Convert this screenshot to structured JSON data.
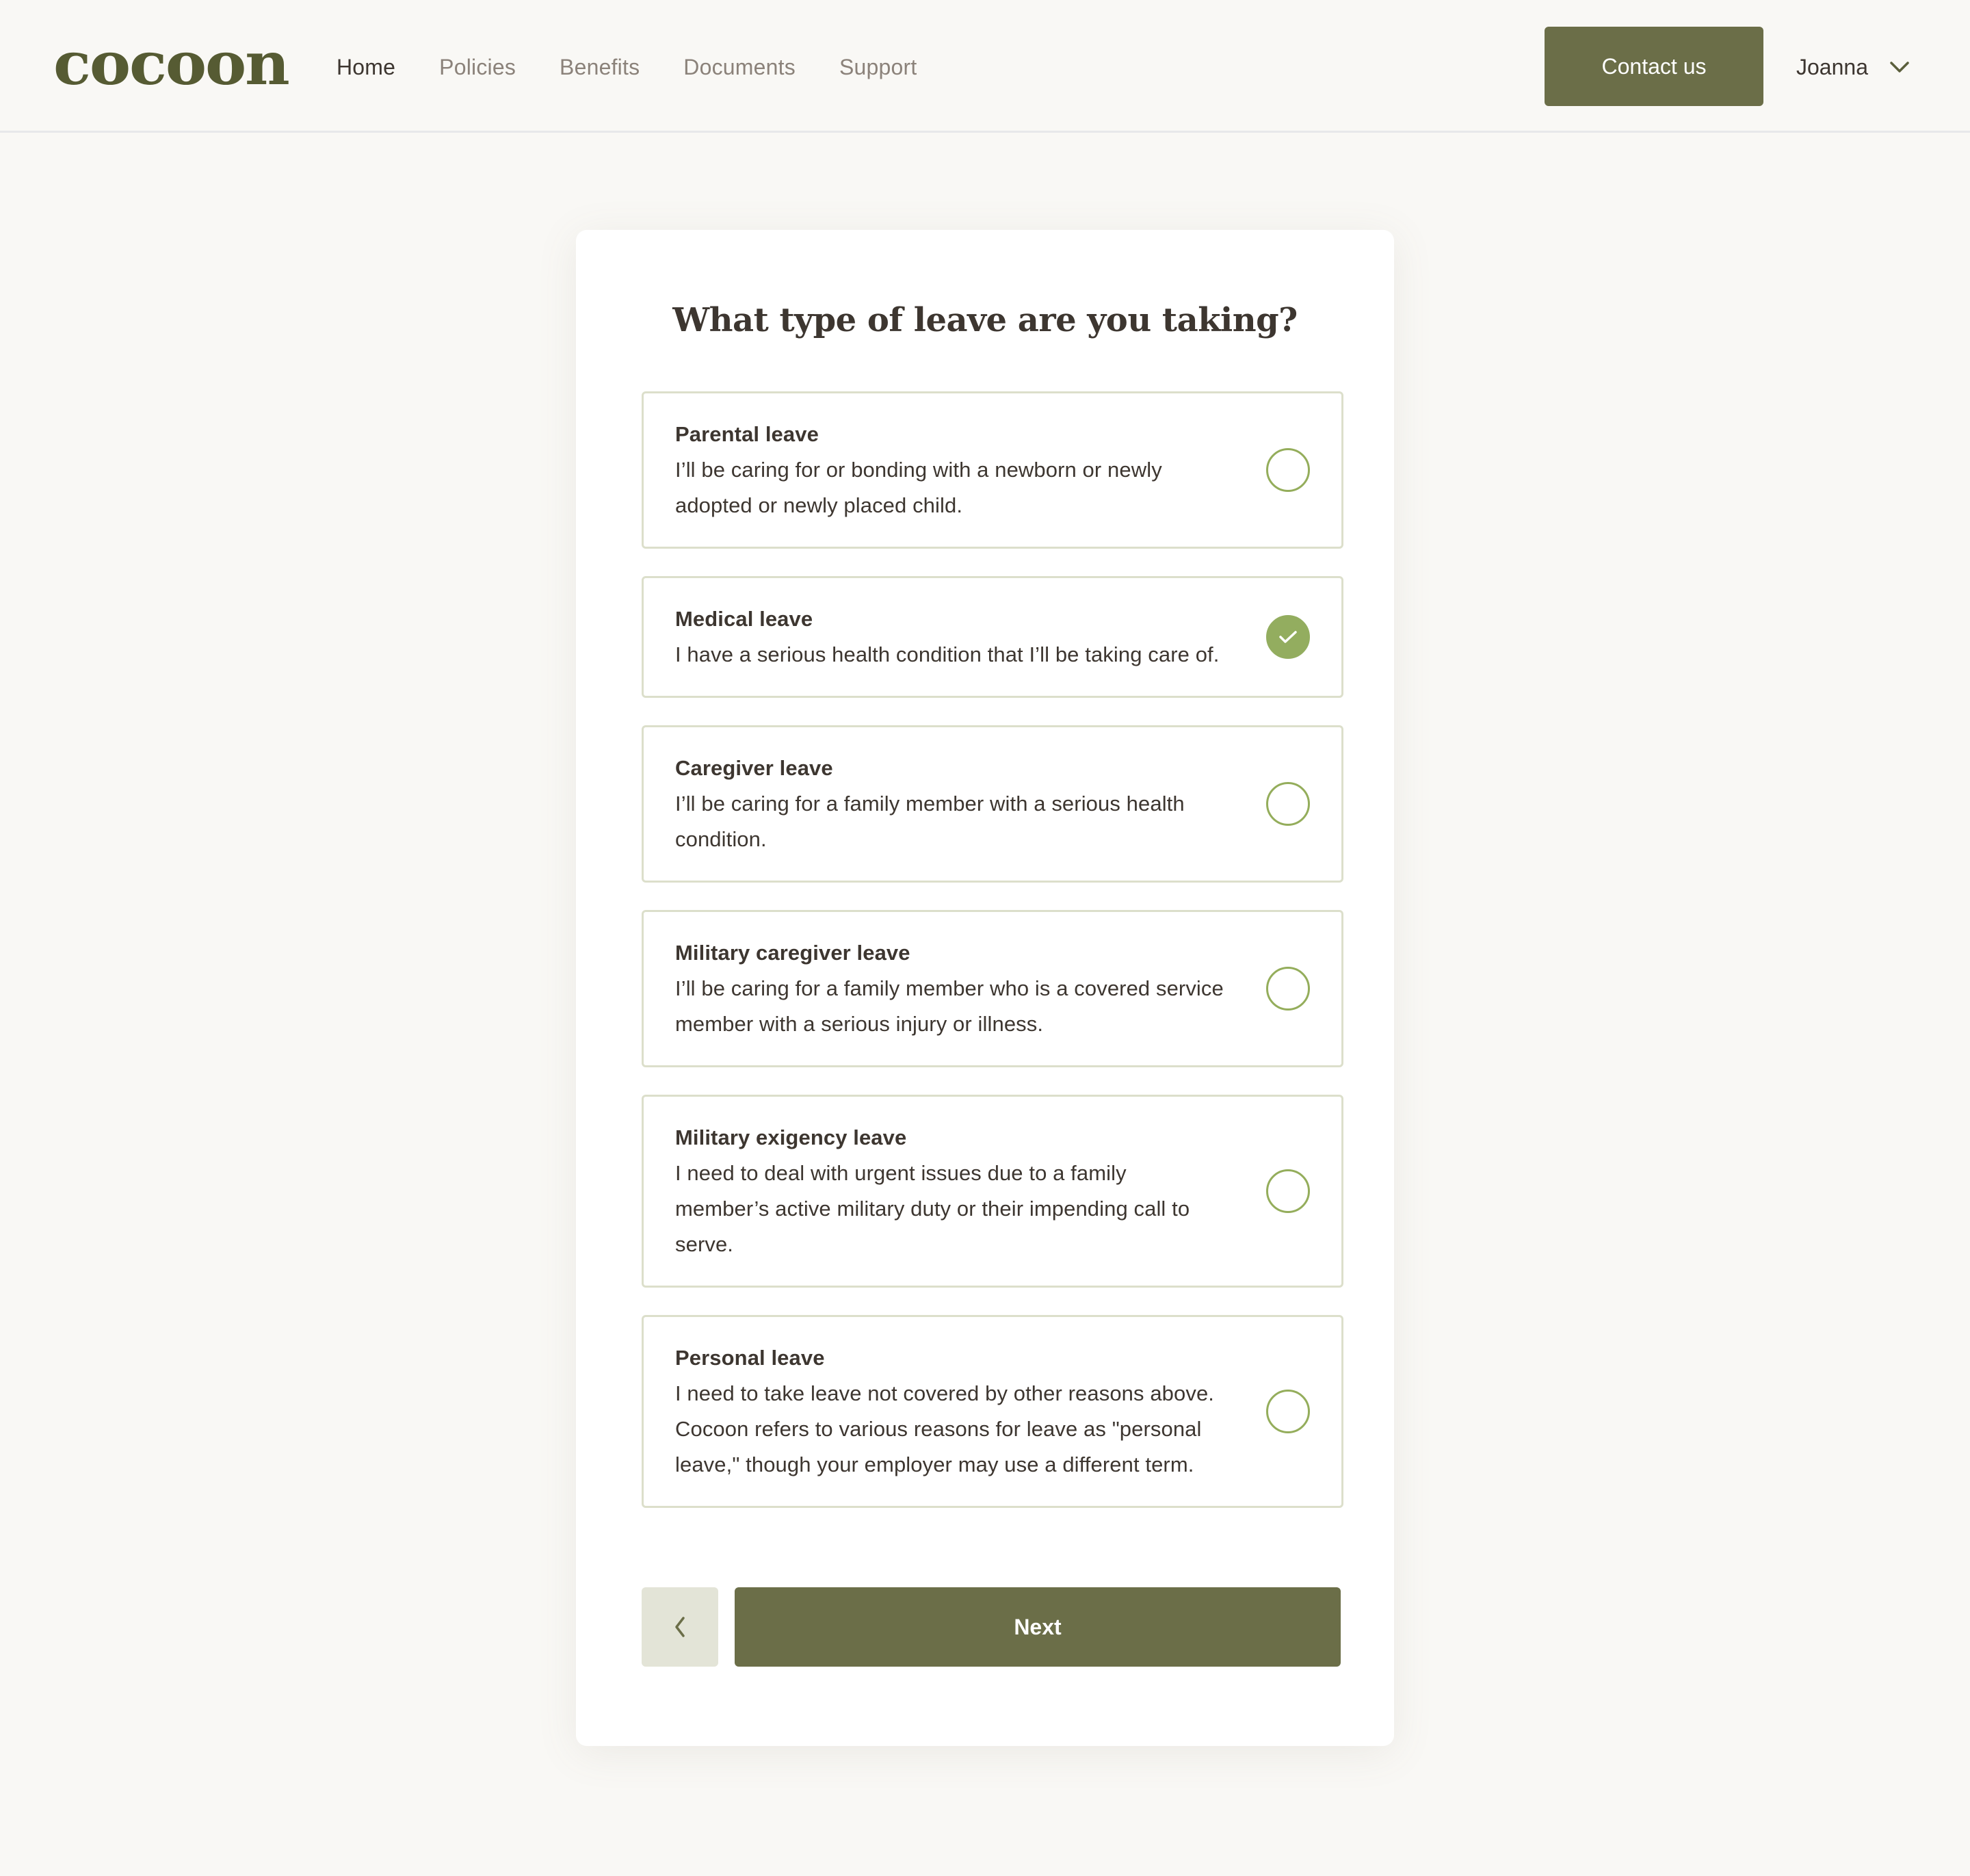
{
  "brand": {
    "logo_text": "cocoon",
    "primary_color": "#6b6e48",
    "logo_color": "#565b33",
    "accent_green": "#93ad5f",
    "background": "#f9f8f5"
  },
  "header": {
    "nav": [
      {
        "label": "Home",
        "active": true
      },
      {
        "label": "Policies",
        "active": false
      },
      {
        "label": "Benefits",
        "active": false
      },
      {
        "label": "Documents",
        "active": false
      },
      {
        "label": "Support",
        "active": false
      }
    ],
    "contact_label": "Contact us",
    "user_name": "Joanna",
    "user_menu_icon": "chevron-down-icon"
  },
  "form": {
    "question": "What type of leave are you taking?",
    "options": [
      {
        "title": "Parental leave",
        "description": "I’ll be caring for or bonding with a newborn or newly adopted or newly placed child.",
        "selected": false
      },
      {
        "title": "Medical leave",
        "description": "I have a serious health condition that I’ll be taking care of.",
        "selected": true
      },
      {
        "title": "Caregiver leave",
        "description": "I’ll be caring for a family member with a serious health condition.",
        "selected": false
      },
      {
        "title": "Military caregiver leave",
        "description": "I’ll be caring for a family member who is a covered service member with a serious injury or illness.",
        "selected": false
      },
      {
        "title": "Military exigency leave",
        "description": "I need to deal with urgent issues due to a family member’s active military duty or their impending call to serve.",
        "selected": false
      },
      {
        "title": "Personal leave",
        "description": "I need to take leave not covered by other reasons above. Cocoon refers to various reasons for leave as \"personal leave,\" though your employer may use a different term.",
        "selected": false
      }
    ],
    "back_icon": "chevron-left-icon",
    "next_label": "Next"
  }
}
